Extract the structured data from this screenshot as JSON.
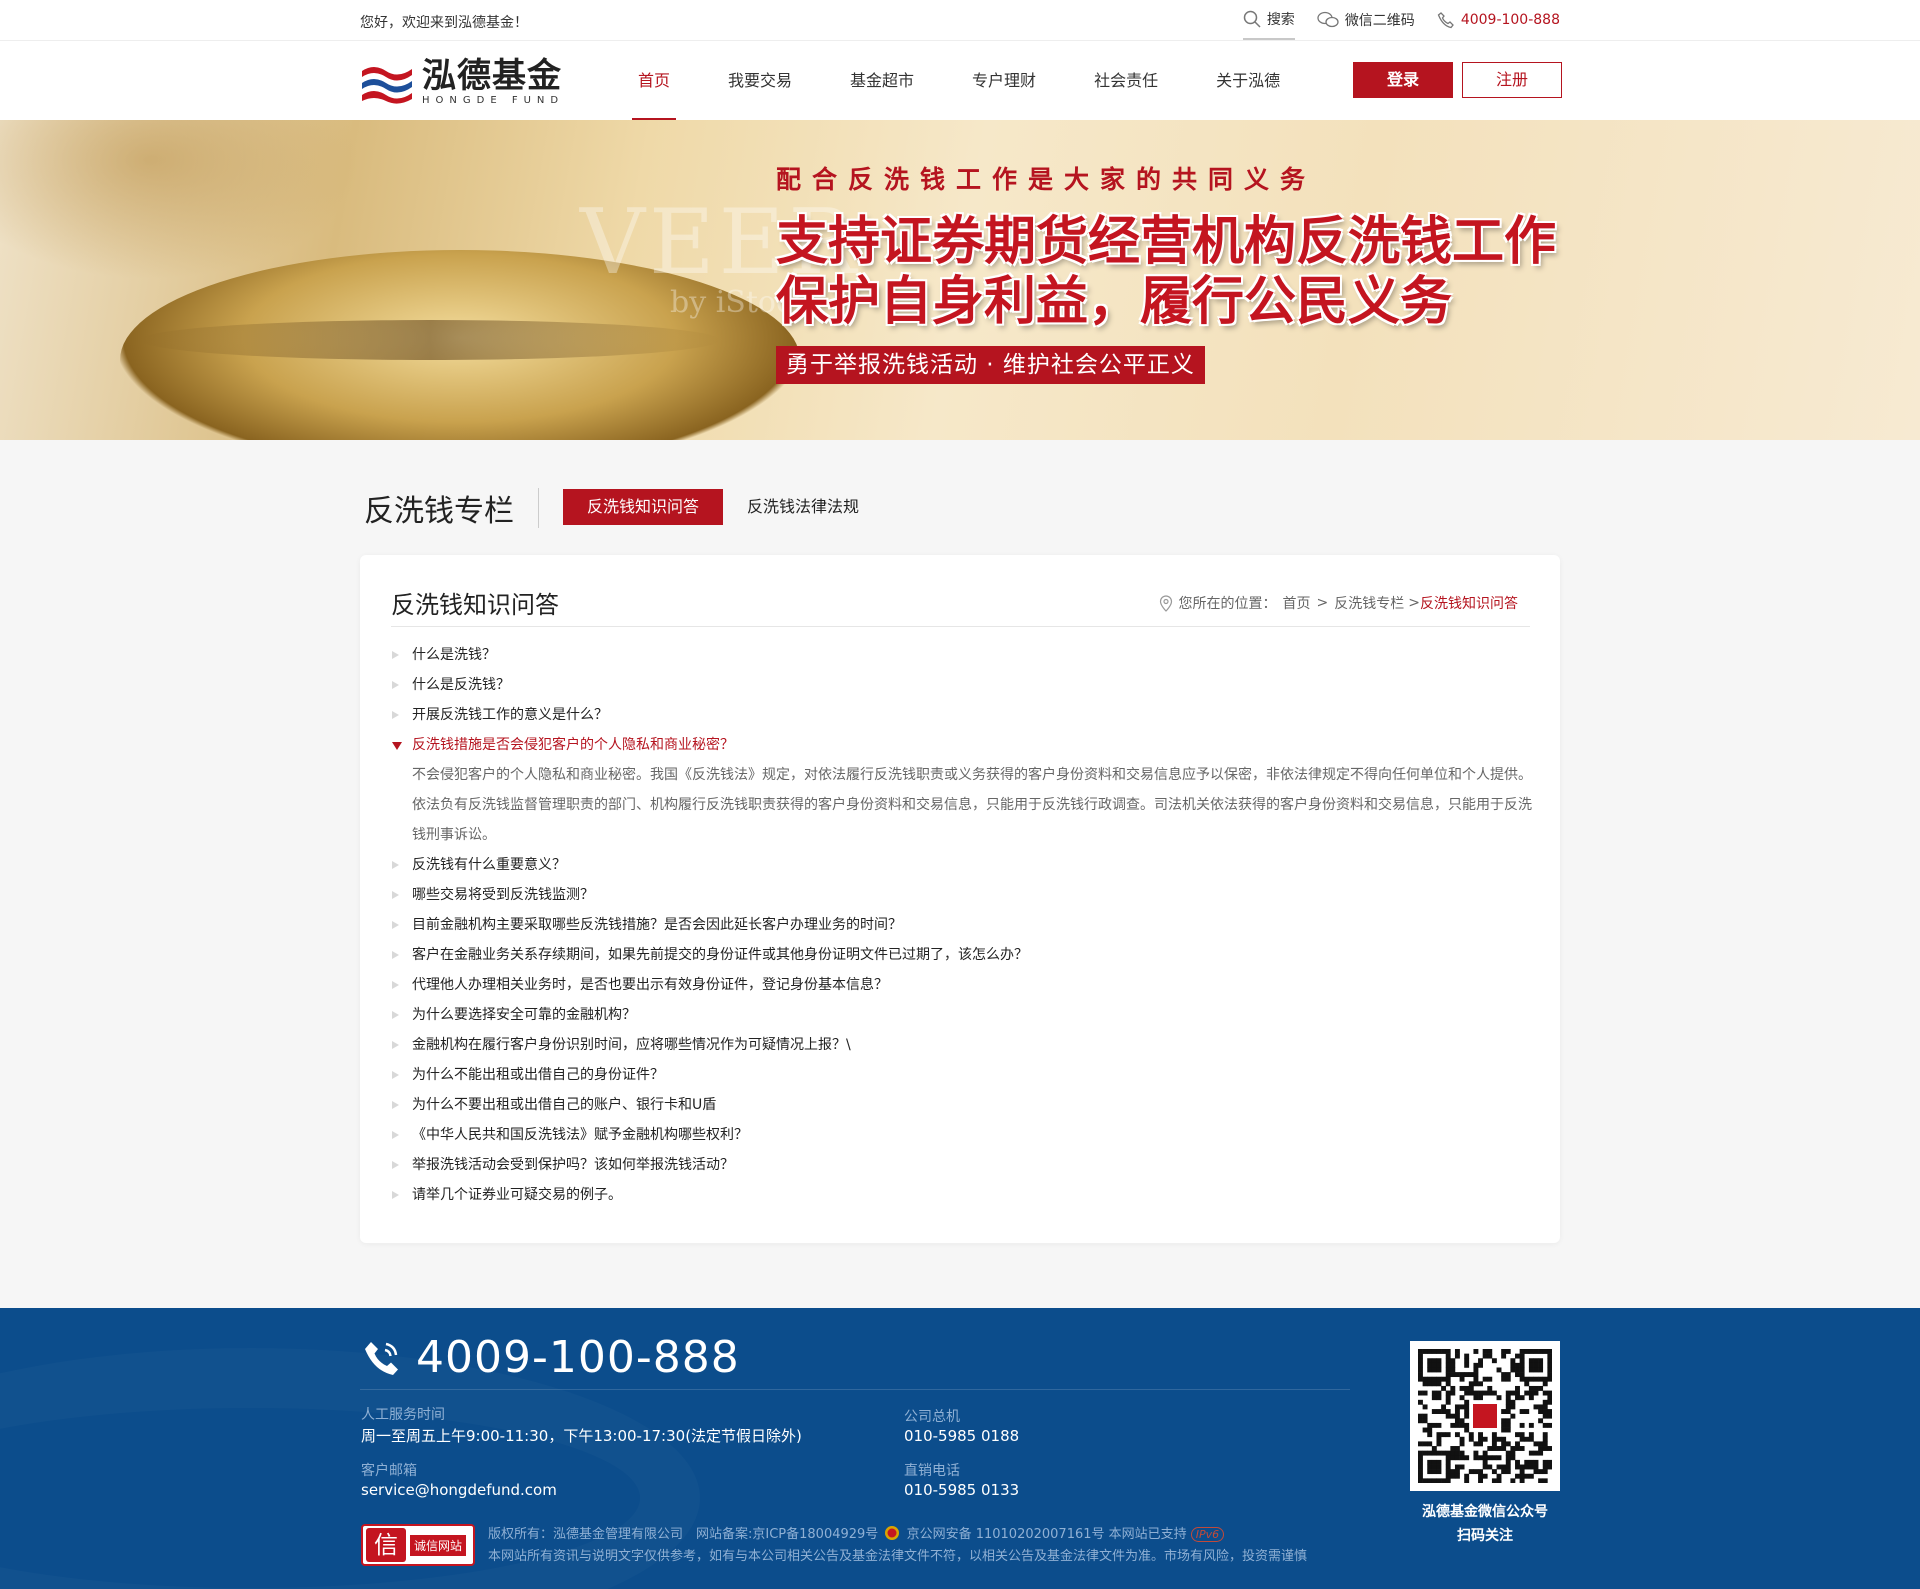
{
  "topbar": {
    "welcome": "您好，欢迎来到泓德基金！",
    "search": "搜索",
    "wechat": "微信二维码",
    "phone": "4009-100-888"
  },
  "header": {
    "logo_cn": "泓德基金",
    "logo_en": "HONGDE FUND",
    "nav": [
      "首页",
      "我要交易",
      "基金超市",
      "专户理财",
      "社会责任",
      "关于泓德"
    ],
    "active_nav": "首页",
    "login": "登录",
    "register": "注册"
  },
  "banner": {
    "subtitle": "配合反洗钱工作是大家的共同义务",
    "line1": "支持证券期货经营机构反洗钱工作",
    "line2": "保护自身利益，履行公民义务",
    "tag": "勇于举报洗钱活动 · 维护社会公平正义",
    "watermark": "VEER",
    "watermark2": "by iStock"
  },
  "section": {
    "title": "反洗钱专栏",
    "tab_active": "反洗钱知识问答",
    "tab_other": "反洗钱法律法规"
  },
  "card": {
    "title": "反洗钱知识问答",
    "crumb_label": "您所在的位置：",
    "crumb": [
      "首页",
      "反洗钱专栏",
      "反洗钱知识问答"
    ],
    "questions": [
      "什么是洗钱？",
      "什么是反洗钱？",
      "开展反洗钱工作的意义是什么？",
      "反洗钱措施是否会侵犯客户的个人隐私和商业秘密？",
      "反洗钱有什么重要意义？",
      "哪些交易将受到反洗钱监测？",
      "目前金融机构主要采取哪些反洗钱措施？是否会因此延长客户办理业务的时间？",
      "客户在金融业务关系存续期间，如果先前提交的身份证件或其他身份证明文件已过期了，该怎么办？",
      "代理他人办理相关业务时，是否也要出示有效身份证件，登记身份基本信息？",
      "为什么要选择安全可靠的金融机构？",
      "金融机构在履行客户身份识别时间，应将哪些情况作为可疑情况上报？\\",
      "为什么不能出租或出借自己的身份证件？",
      "为什么不要出租或出借自己的账户、银行卡和U盾",
      "《中华人民共和国反洗钱法》赋予金融机构哪些权利？",
      "举报洗钱活动会受到保护吗？该如何举报洗钱活动？",
      "请举几个证券业可疑交易的例子。"
    ],
    "open_index": 3,
    "answer": "不会侵犯客户的个人隐私和商业秘密。我国《反洗钱法》规定，对依法履行反洗钱职责或义务获得的客户身份资料和交易信息应予以保密，非依法律规定不得向任何单位和个人提供。依法负有反洗钱监督管理职责的部门、机构履行反洗钱职责获得的客户身份资料和交易信息，只能用于反洗钱行政调查。司法机关依法获得的客户身份资料和交易信息，只能用于反洗钱刑事诉讼。"
  },
  "footer": {
    "phone": "4009-100-888",
    "service_time_label": "人工服务时间",
    "service_time": "周一至周五上午9:00-11:30，下午13:00-17:30(法定节假日除外)",
    "email_label": "客户邮箱",
    "email": "service@hongdefund.com",
    "hq_label": "公司总机",
    "hq": "010-5985 0188",
    "direct_label": "直销电话",
    "direct": "010-5985 0133",
    "badge_icon": "信",
    "badge_text": "诚信网站",
    "copyright": "版权所有：泓德基金管理有限公司　网站备案:京ICP备18004929号",
    "police": "京公网安备 11010202007161号 本网站已支持",
    "ipv6": "IPv6",
    "disclaimer": "本网站所有资讯与说明文字仅供参考，如有与本公司相关公告及基金法律文件不符，以相关公告及基金法律文件为准。市场有风险，投资需谨慎",
    "qr_caption1": "泓德基金微信公众号",
    "qr_caption2": "扫码关注"
  },
  "colors": {
    "brand_red": "#b5141f",
    "footer_blue": "#0c4d8c"
  }
}
